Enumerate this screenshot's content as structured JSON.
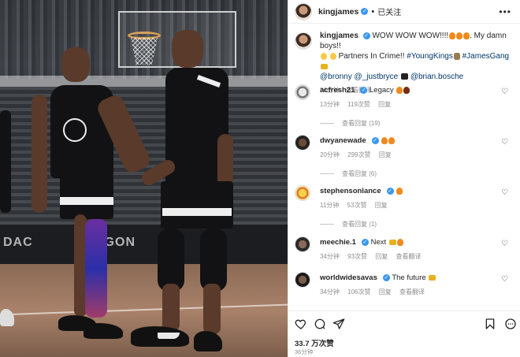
{
  "post": {
    "author": "kingjames",
    "follow_state": "已关注",
    "more_label": "•••"
  },
  "caption": {
    "author": "kingjames",
    "text_main": "WOW WOW WOW!!!!",
    "text_after_fire": ". My damn boys!!",
    "text_line2": "Partners In Crime!!",
    "hashtag1": "#YoungKings",
    "hashtag2": "#JamesGang",
    "mention1": "@bronny",
    "mention2": "@_justbryce",
    "mention3": "@brian.bosche",
    "time": "36分钟",
    "translate": "查看翻译"
  },
  "comments": [
    {
      "user": "acfresh21",
      "text": "Legacy",
      "time": "13分钟",
      "likes": "119次赞",
      "reply": "回复",
      "view_replies": "查看回复 (19)"
    },
    {
      "user": "dwyanewade",
      "text": "",
      "time": "20分钟",
      "likes": "299次赞",
      "reply": "回复",
      "view_replies": "查看回复 (6)"
    },
    {
      "user": "stephensonlance",
      "text": "",
      "time": "11分钟",
      "likes": "53次赞",
      "reply": "回复",
      "view_replies": "查看回复 (1)"
    },
    {
      "user": "meechie.1",
      "text": "Next",
      "time": "34分钟",
      "likes": "93次赞",
      "reply": "回复",
      "translate": "查看翻译"
    },
    {
      "user": "worldwidesavas",
      "text": "The future",
      "time": "34分钟",
      "likes": "106次赞",
      "reply": "回复",
      "translate": "查看翻译"
    }
  ],
  "footer": {
    "likes": "33.7 万次赞",
    "time": "36分钟"
  },
  "photo": {
    "ad_text_left": "DAC",
    "ad_text_mid": "AGON"
  },
  "colors": {
    "verified": "#3897f0",
    "link": "#00376b",
    "muted": "#8e8e8e"
  }
}
